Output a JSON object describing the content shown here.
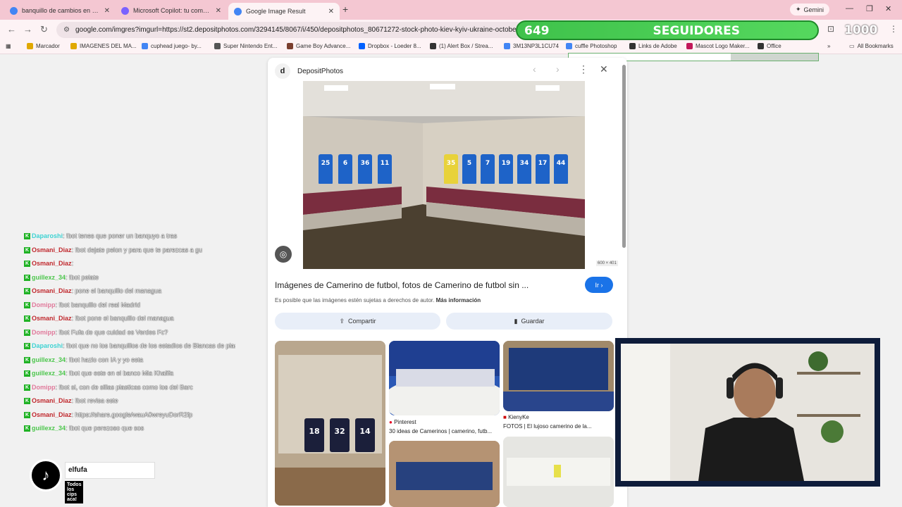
{
  "tabs": [
    {
      "title": "banquillo de cambios en estad",
      "favicon_color": "#4285f4",
      "active": false
    },
    {
      "title": "Microsoft Copilot: tu complem",
      "favicon_color": "#7b61ff",
      "active": false
    },
    {
      "title": "Google Image Result",
      "favicon_color": "#4285f4",
      "active": true
    }
  ],
  "new_tab_label": "+",
  "gemini_label": "Gemini",
  "address_bar": {
    "url": "google.com/imgres?imgurl=https://st2.depositphotos.com/3294145/8067/i/450/depositphotos_80671272-stock-photo-kiev-kyiv-ukraine-october-04.jpg&tbnid=...photos/..."
  },
  "bookmarks": [
    {
      "label": "Marcador",
      "color": "#e0a800"
    },
    {
      "label": "IMAGENES DEL MA...",
      "color": "#e0a800"
    },
    {
      "label": "cuphead juego- by...",
      "color": "#4285f4"
    },
    {
      "label": "Super Nintendo Ent...",
      "color": "#555555"
    },
    {
      "label": "Game Boy Advance...",
      "color": "#7a3e2e"
    },
    {
      "label": "Dropbox - Loeder 8...",
      "color": "#0061ff"
    },
    {
      "label": "(1) Alert Box / Strea...",
      "color": "#333333"
    },
    {
      "label": "3M13NP3L1CU74",
      "color": "#4285f4"
    },
    {
      "label": "cuffle Photoshop",
      "color": "#4285f4"
    },
    {
      "label": "Links de Adobe",
      "color": "#333333"
    },
    {
      "label": "Mascot Logo Maker...",
      "color": "#c2185b"
    },
    {
      "label": "Office",
      "color": "#333333"
    }
  ],
  "all_bookmarks_label": "All Bookmarks",
  "followers": {
    "count": "649",
    "label": "SEGUIDORES",
    "goal": "1000",
    "progress": 0.649,
    "color": "#3fc24b"
  },
  "panel": {
    "source": "DepositPhotos",
    "image_dims": "600 × 401",
    "title": "Imágenes de Camerino de futbol, fotos de Camerino de futbol sin ...",
    "go_label": "Ir",
    "copyright_text": "Es posible que las imágenes estén sujetas a derechos de autor.",
    "more_info": "Más información",
    "share_label": "Compartir",
    "save_label": "Guardar",
    "jersey_numbers": [
      "25",
      "6",
      "36",
      "11",
      "35",
      "5",
      "7",
      "19",
      "34",
      "17",
      "44"
    ],
    "related": [
      {
        "source": "Pinterest",
        "caption": "30 ideas de Camerinos | camerino, futb..."
      },
      {
        "source": "KienyKe",
        "caption": "FOTOS | El lujoso camerino de la..."
      }
    ],
    "thumb_jerseys": [
      "18",
      "32",
      "14"
    ]
  },
  "chat": [
    {
      "user": "Daparoshi",
      "user_color": "#3fd3d3",
      "text": ": !bot tenes que poner un banquyo a tras"
    },
    {
      "user": "Osmani_Diaz",
      "user_color": "#c0282d",
      "text": ": !bot dejate pelon y para que te parezcas a gu"
    },
    {
      "user": "Osmani_Diaz",
      "user_color": "#c0282d",
      "text": ": "
    },
    {
      "user": "guillexz_34",
      "user_color": "#4cc64c",
      "text": ": !bot pelate"
    },
    {
      "user": "Osmani_Diaz",
      "user_color": "#c0282d",
      "text": ": pone el banquillo del managua"
    },
    {
      "user": "Domipp",
      "user_color": "#e07a9b",
      "text": ": !bot banquillo del real Madrid"
    },
    {
      "user": "Osmani_Diaz",
      "user_color": "#c0282d",
      "text": ": !bot pone el banquillo del managua"
    },
    {
      "user": "Domipp",
      "user_color": "#e07a9b",
      "text": ": !bot Fufa de que cuidad es Verdes Fc?"
    },
    {
      "user": "Daparoshi",
      "user_color": "#3fd3d3",
      "text": ": !bot que no los banquillos de los estadios de Blancas de plasticos"
    },
    {
      "user": "guillexz_34",
      "user_color": "#4cc64c",
      "text": ": !bot hazlo con IA y yo esta"
    },
    {
      "user": "guillexz_34",
      "user_color": "#4cc64c",
      "text": ": !bot que este en el banco Mia Khalifa"
    },
    {
      "user": "Domipp",
      "user_color": "#e07a9b",
      "text": ": !bot si, con de sillas plasticas como los del Barc"
    },
    {
      "user": "Osmani_Diaz",
      "user_color": "#c0282d",
      "text": ": !bot revisa este"
    },
    {
      "user": "Osmani_Diaz",
      "user_color": "#c0282d",
      "text": ": https://share.google/wauA0wreyuDorR2fp"
    },
    {
      "user": "guillexz_34",
      "user_color": "#4cc64c",
      "text": ": !bot que perezoso que sos"
    }
  ],
  "tiktok": {
    "username": "elfufa",
    "tagline": "Todos los cips aca!"
  }
}
